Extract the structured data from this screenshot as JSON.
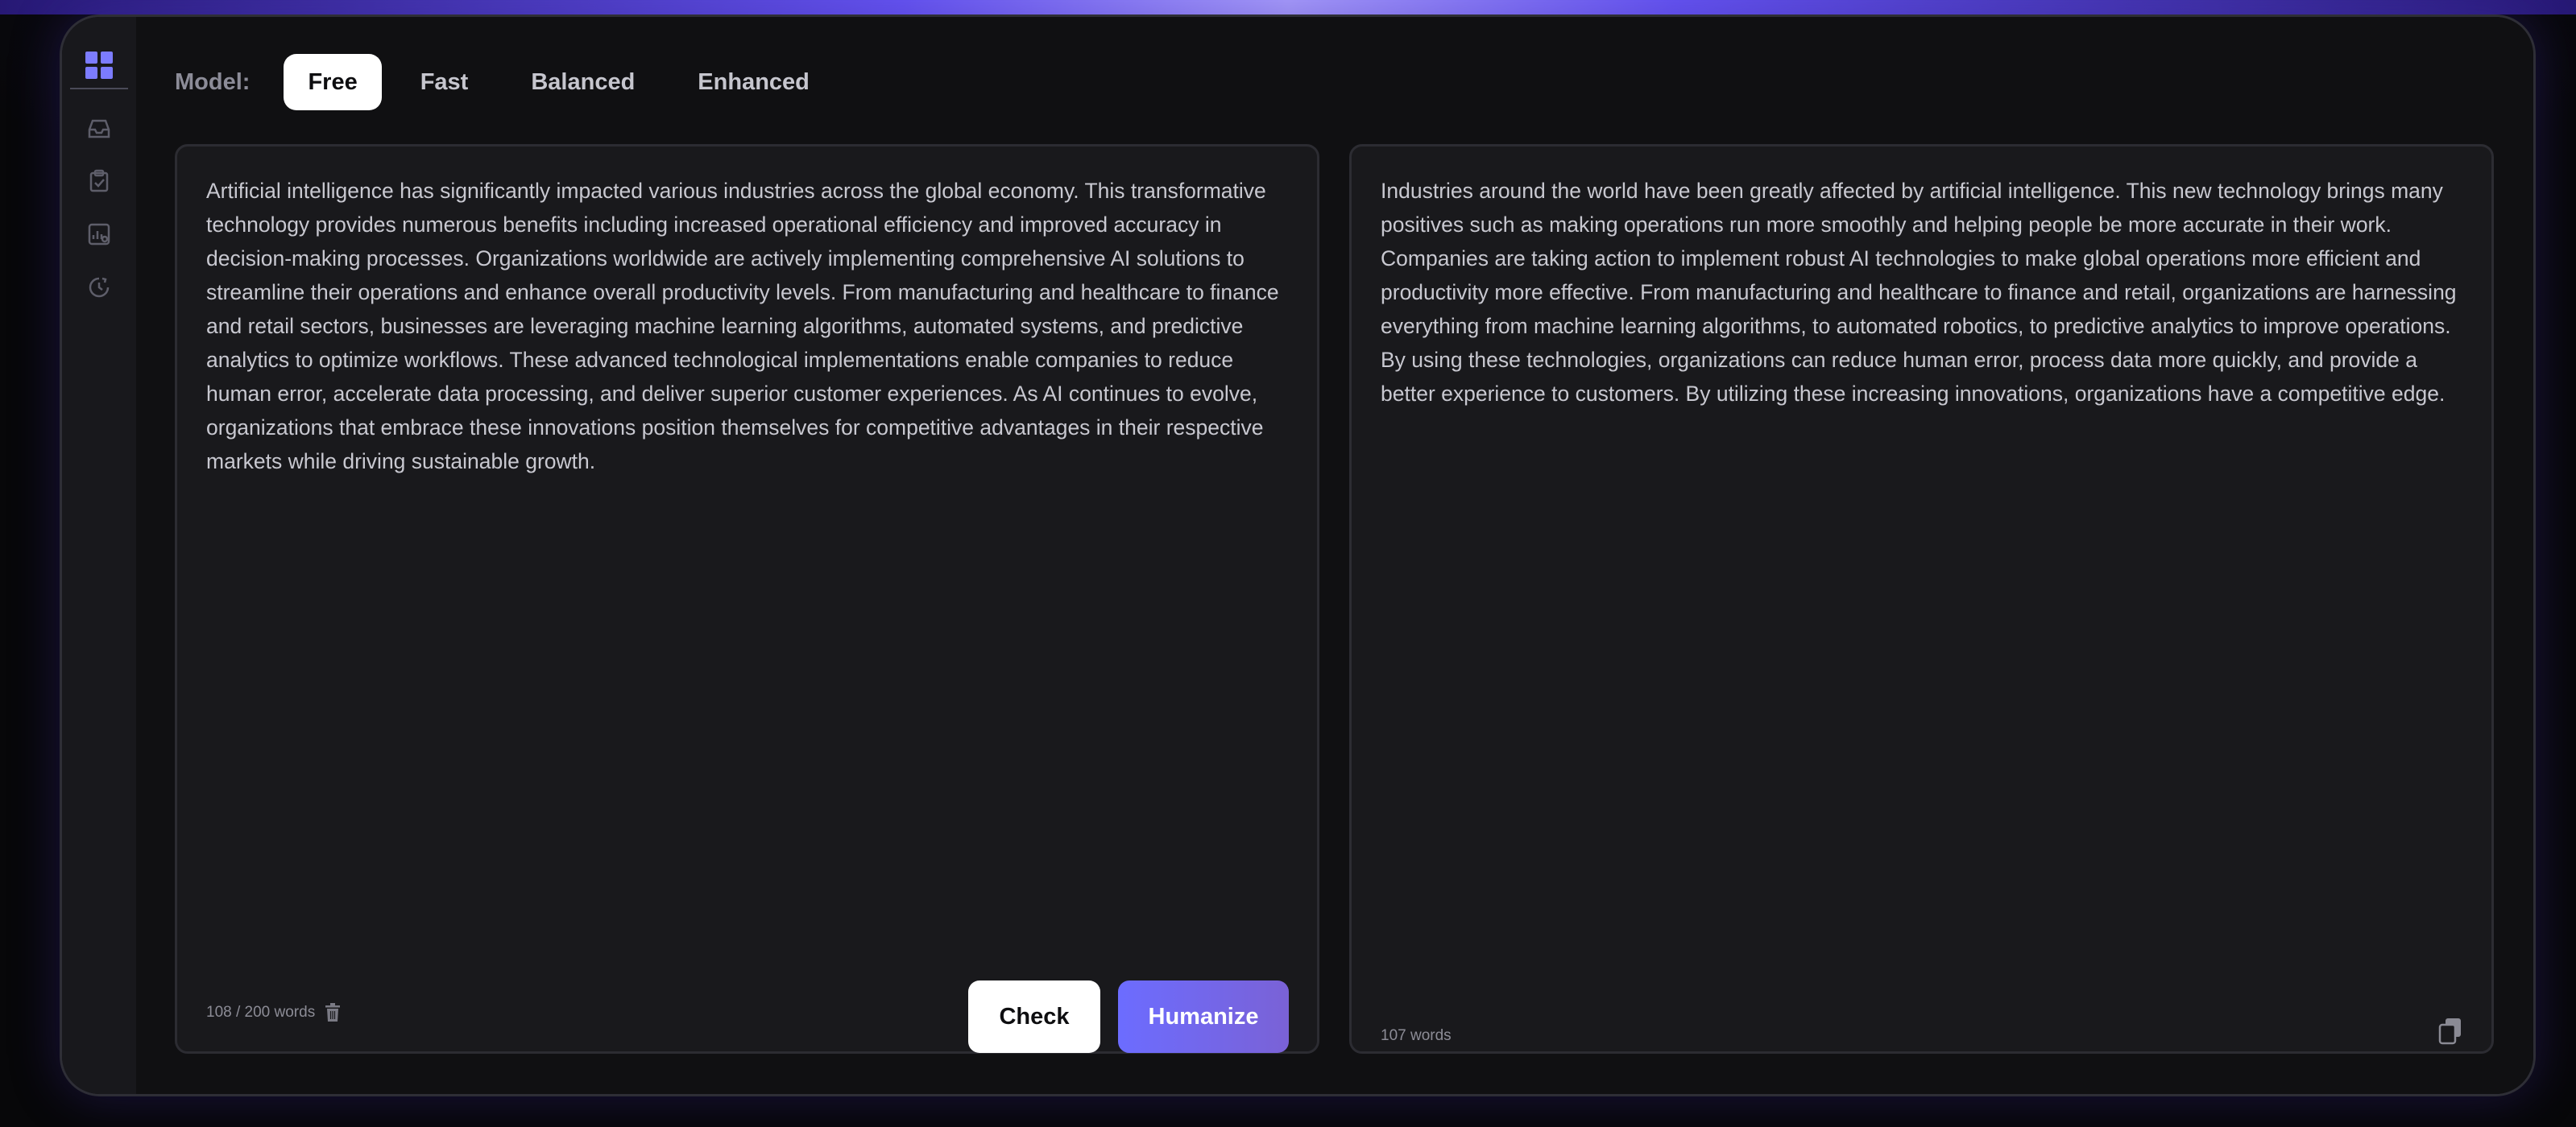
{
  "model": {
    "label": "Model:",
    "tabs": [
      {
        "label": "Free",
        "active": true
      },
      {
        "label": "Fast",
        "active": false
      },
      {
        "label": "Balanced",
        "active": false
      },
      {
        "label": "Enhanced",
        "active": false
      }
    ]
  },
  "sidebar": {
    "items": [
      {
        "icon": "dashboard-grid-icon",
        "active": true
      },
      {
        "icon": "inbox-icon",
        "active": false
      },
      {
        "icon": "clipboard-check-icon",
        "active": false
      },
      {
        "icon": "analytics-icon",
        "active": false
      },
      {
        "icon": "history-icon",
        "active": false
      }
    ]
  },
  "input_panel": {
    "text": "Artificial intelligence has significantly impacted various industries across the global economy. This transformative technology provides numerous benefits including increased operational efficiency and improved accuracy in decision-making processes. Organizations worldwide are actively implementing comprehensive AI solutions to streamline their operations and enhance overall productivity levels. From manufacturing and healthcare to finance and retail sectors, businesses are leveraging machine learning algorithms, automated systems, and predictive analytics to optimize workflows. These advanced technological implementations enable companies to reduce human error, accelerate data processing, and deliver superior customer experiences. As AI continues to evolve, organizations that embrace these innovations position themselves for competitive advantages in their respective markets while driving sustainable growth.",
    "word_count": "108 / 200 words",
    "check_label": "Check",
    "humanize_label": "Humanize"
  },
  "output_panel": {
    "text": "Industries around the world have been greatly affected by artificial intelligence. This new technology brings many positives such as making operations run more smoothly and helping people be more accurate in their work. Companies are taking action to implement robust AI technologies to make global operations more efficient and productivity more effective. From manufacturing and healthcare to finance and retail, organizations are harnessing everything from machine learning algorithms, to automated robotics, to predictive analytics to improve operations. By using these technologies, organizations can reduce human error, process data more quickly, and provide a better experience to customers. By utilizing these increasing innovations, organizations have a competitive edge.",
    "word_count": "107 words"
  },
  "colors": {
    "accent": "#6c6cff",
    "humanize_gradient_end": "#7a62d6",
    "background": "#070709",
    "panel": "#19191c"
  }
}
